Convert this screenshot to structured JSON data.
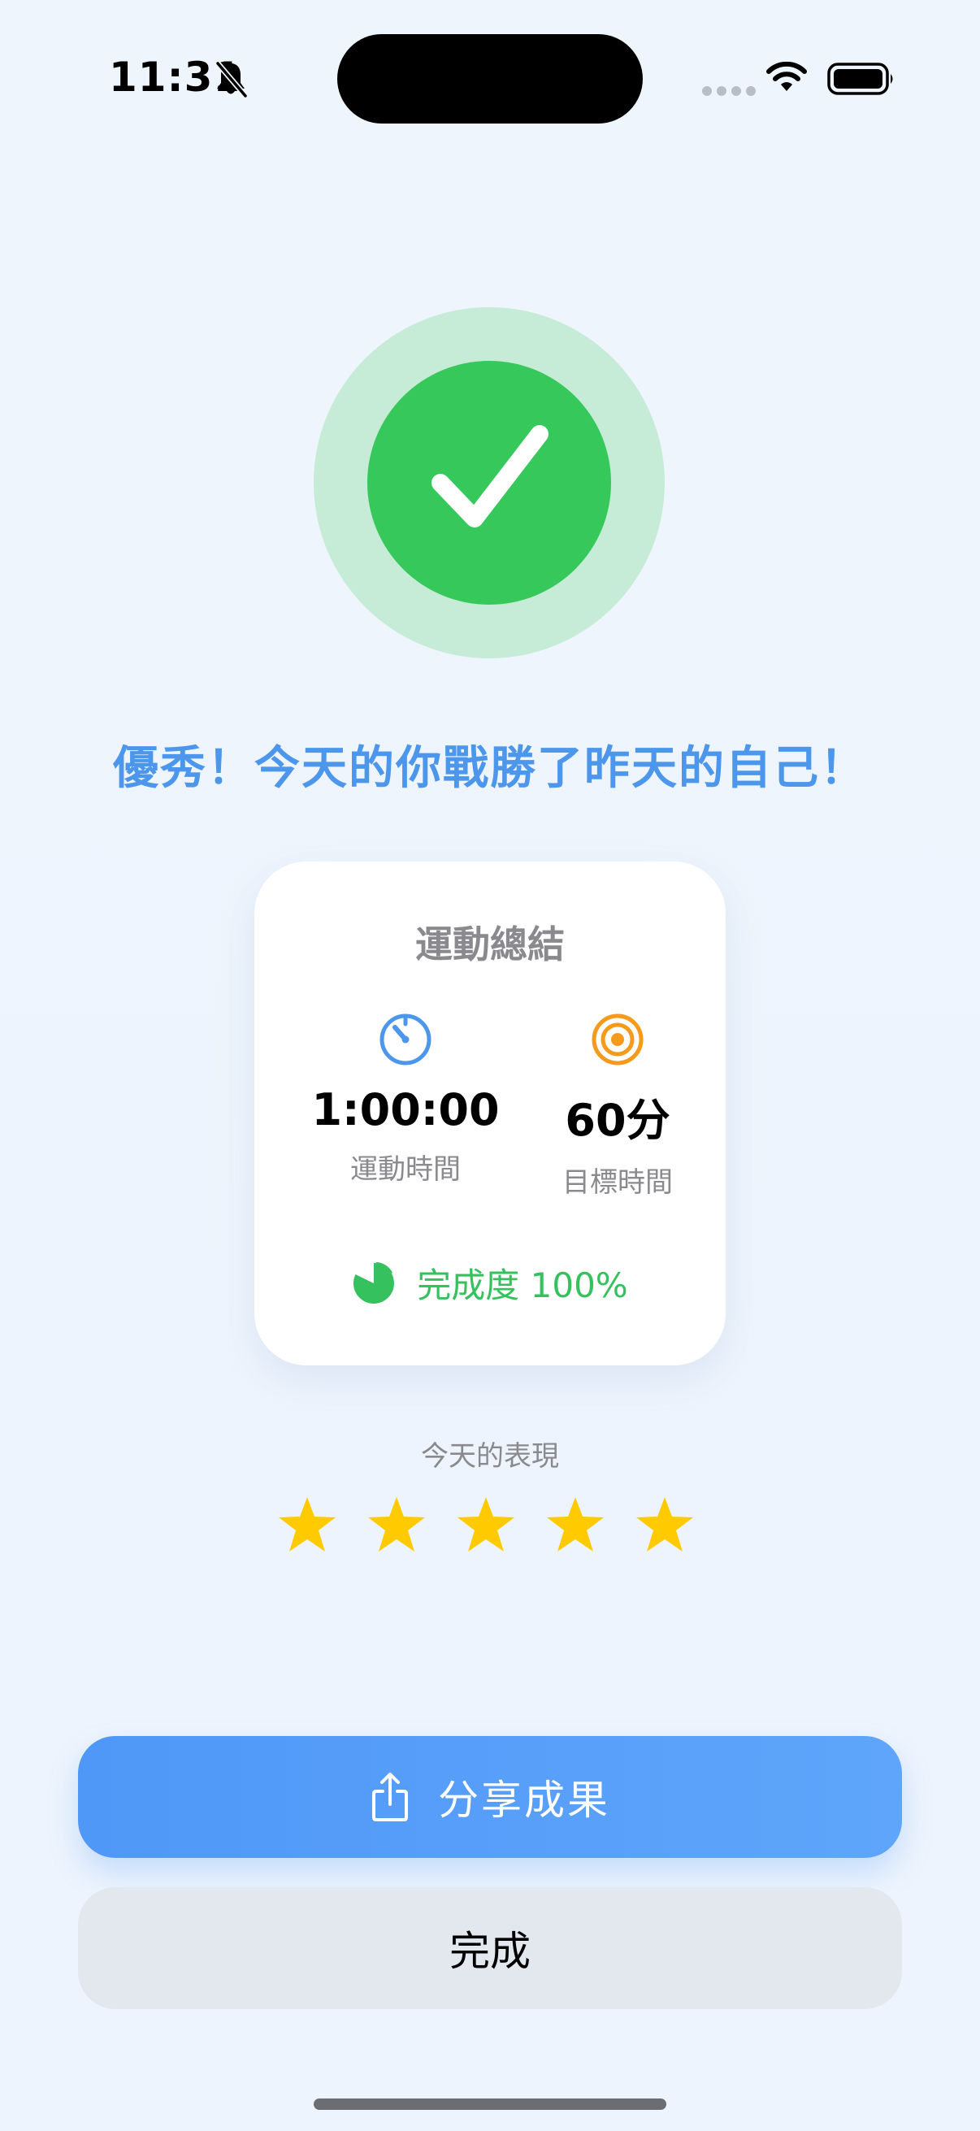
{
  "status_bar": {
    "time": "11:31",
    "mute_icon": "bell-slash-icon",
    "wifi_icon": "wifi-icon",
    "battery_icon": "battery-full-icon"
  },
  "success_mark": {
    "icon": "checkmark-icon",
    "color": "#37c85b",
    "halo_color": "#c6ebd6"
  },
  "headline": "優秀！今天的你戰勝了昨天的自己！",
  "summary": {
    "title": "運動總結",
    "stats": [
      {
        "icon": "timer-icon",
        "value": "1:00:00",
        "label": "運動時間",
        "color": "#4c97eb"
      },
      {
        "icon": "target-icon",
        "value": "60分",
        "label": "目標時間",
        "color": "#f59a1b"
      }
    ],
    "completion": {
      "icon": "pie-chart-icon",
      "text": "完成度 100%",
      "color": "#35c15d"
    }
  },
  "performance": {
    "label": "今天的表現",
    "rating": 5,
    "max": 5,
    "star_color": "#ffcb00"
  },
  "buttons": {
    "share": {
      "icon": "share-icon",
      "label": "分享成果"
    },
    "done": {
      "label": "完成"
    }
  },
  "colors": {
    "accent": "#4f98f7",
    "background": "#eef5fd"
  }
}
